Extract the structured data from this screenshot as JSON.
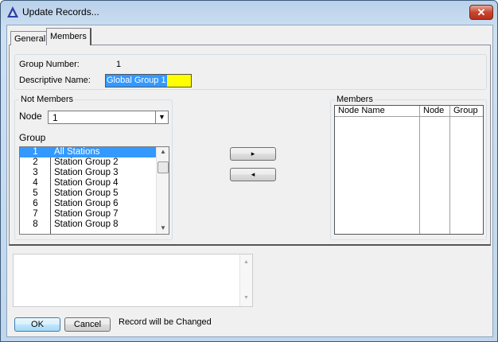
{
  "window": {
    "title": "Update Records...",
    "close_label": "✕"
  },
  "tabs": [
    {
      "label": "General"
    },
    {
      "label": "Members",
      "selected": true
    }
  ],
  "info": {
    "group_number_label": "Group Number:",
    "group_number_value": "1",
    "descriptive_name_label": "Descriptive Name:",
    "descriptive_name_value": "Global Group 1"
  },
  "not_members": {
    "legend": "Not Members",
    "node_label": "Node",
    "node_value": "1",
    "group_label": "Group",
    "groups": [
      {
        "num": "1",
        "name": "All Stations"
      },
      {
        "num": "2",
        "name": "Station Group 2"
      },
      {
        "num": "3",
        "name": "Station Group 3"
      },
      {
        "num": "4",
        "name": "Station Group 4"
      },
      {
        "num": "5",
        "name": "Station Group 5"
      },
      {
        "num": "6",
        "name": "Station Group 6"
      },
      {
        "num": "7",
        "name": "Station Group 7"
      },
      {
        "num": "8",
        "name": "Station Group 8"
      }
    ]
  },
  "transfer": {
    "add_label": "▸",
    "remove_label": "◂"
  },
  "members": {
    "legend": "Members",
    "columns": [
      "Node Name",
      "Node",
      "Group"
    ]
  },
  "footer": {
    "ok_label": "OK",
    "cancel_label": "Cancel",
    "status": "Record will be Changed"
  },
  "colors": {
    "highlight": "#3399ff",
    "input_bg": "#ffff00"
  }
}
